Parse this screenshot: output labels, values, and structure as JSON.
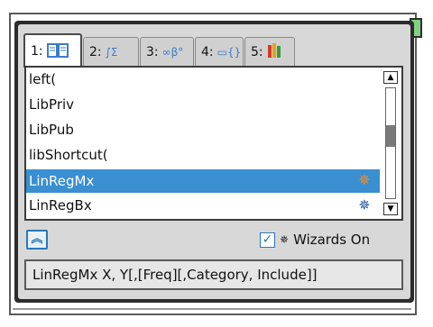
{
  "tabs": [
    {
      "num": "1:",
      "icon": "catalog-book-icon",
      "glyph": "📖"
    },
    {
      "num": "2:",
      "icon": "integral-sum-icon",
      "glyph": "∫Σ"
    },
    {
      "num": "3:",
      "icon": "infinity-beta-icon",
      "glyph": "∞β°"
    },
    {
      "num": "4:",
      "icon": "units-icon",
      "glyph": "▭{}"
    },
    {
      "num": "5:",
      "icon": "library-books-icon",
      "glyph": "▮▮"
    }
  ],
  "list": {
    "items": [
      {
        "label": "left(",
        "selected": false,
        "wizard": null
      },
      {
        "label": "LibPriv",
        "selected": false,
        "wizard": null
      },
      {
        "label": "LibPub",
        "selected": false,
        "wizard": null
      },
      {
        "label": "libShortcut(",
        "selected": false,
        "wizard": null
      },
      {
        "label": "LinRegMx",
        "selected": true,
        "wizard": "wizard-wand-icon"
      },
      {
        "label": "LinRegBx",
        "selected": false,
        "wizard": "wizard-wand-icon"
      }
    ],
    "scroll_position": 0.42
  },
  "controls": {
    "collapse_icon": "double-chevron-up-icon",
    "wizards_checked": true,
    "wizards_label": "Wizards On"
  },
  "syntax_help": "LinRegMx X, Y[,[Freq][,Category, Include]]",
  "colors": {
    "selection": "#3a8fd0",
    "accent": "#2b77b8",
    "wizard_selected": "#f08a2a",
    "wizard_normal": "#205a9a"
  }
}
